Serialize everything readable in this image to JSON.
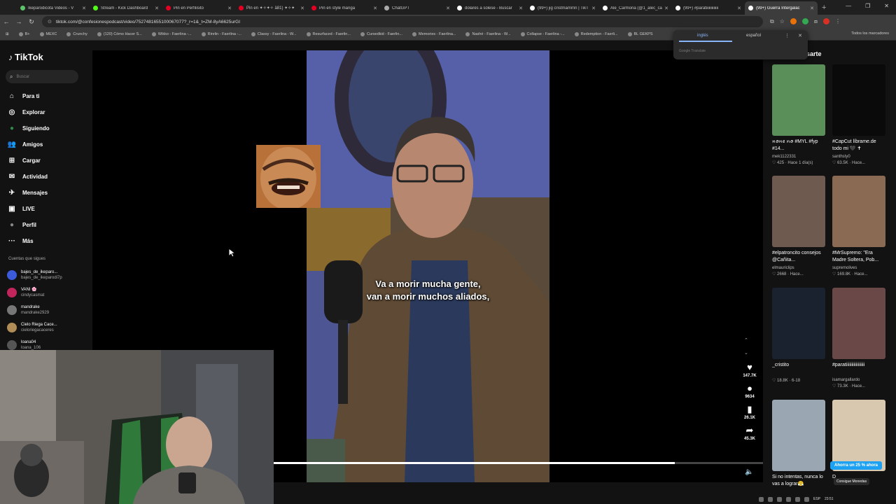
{
  "browser": {
    "tabs": [
      {
        "title": "Ikeparodicota Videos - V",
        "color": "#5ec26a"
      },
      {
        "title": "Stream - Kick Dashboard",
        "color": "#53fc18"
      },
      {
        "title": "Pin en Perfilisito",
        "color": "#e60023"
      },
      {
        "title": "Pin en ✦✧✦✧ ä81) ✦✧✦",
        "color": "#e60023"
      },
      {
        "title": "Pin en style manga",
        "color": "#e60023"
      },
      {
        "title": "ChatGPT",
        "color": "#aaaaaa"
      },
      {
        "title": "dolares a solese - Buscar",
        "color": "#ffffff"
      },
      {
        "title": "(99+) jig cristmamrnn | TikT",
        "color": "#ffffff"
      },
      {
        "title": "Ale_Carmona (@1_alec_ca",
        "color": "#ffffff"
      },
      {
        "title": "(99+) #paratiiiiiiiiiiiii",
        "color": "#ffffff"
      },
      {
        "title": "(99+) Guerra Intergalac",
        "color": "#ffffff"
      }
    ],
    "url": "tiktok.com/@confesionespodcast/video/7527481655100067077?_r=1&_t=ZM-8yA6625urGI",
    "bookmarks": [
      "B+",
      "MEXC",
      "Crunchy",
      "(120) Cómo Hacer S...",
      "Wikko - Faerlina -...",
      "Rinrlin - Faerlina -...",
      "Classy - Faerlina - W...",
      "Resurfaced - Faerlin...",
      "Cursedkid - Faerlin...",
      "Memories - Faerlina...",
      "Nashé - Faerlina - W...",
      "Collapse - Faerlina -...",
      "Redemption - Faerli...",
      "BL GEKPS"
    ],
    "bookmarks_right": "Todos los marcadores"
  },
  "translate": {
    "lang1": "inglés",
    "lang2": "español",
    "footer": "Google Translate"
  },
  "sidebar": {
    "logo": "TikTok",
    "search_placeholder": "Buscar",
    "nav": [
      {
        "label": "Para ti",
        "icon": "home-icon",
        "glyph": "⌂"
      },
      {
        "label": "Explorar",
        "icon": "compass-icon",
        "glyph": "◎"
      },
      {
        "label": "Siguiendo",
        "icon": "following-avatar-icon",
        "glyph": "●"
      },
      {
        "label": "Amigos",
        "icon": "friends-icon",
        "glyph": "👥"
      },
      {
        "label": "Cargar",
        "icon": "upload-icon",
        "glyph": "⊞"
      },
      {
        "label": "Actividad",
        "icon": "activity-icon",
        "glyph": "✉"
      },
      {
        "label": "Mensajes",
        "icon": "messages-icon",
        "glyph": "✈"
      },
      {
        "label": "LIVE",
        "icon": "live-icon",
        "glyph": "▣"
      },
      {
        "label": "Perfil",
        "icon": "profile-icon",
        "glyph": "●"
      },
      {
        "label": "Más",
        "icon": "more-icon",
        "glyph": "···"
      }
    ],
    "follow_title": "Cuentas que sigues",
    "follows": [
      {
        "name": "bajes_de_ikeparo...",
        "user": "bajes_de_ikeparodi7p",
        "color": "#3b5bdb"
      },
      {
        "name": "VANI 🌸",
        "user": "cindycasmat",
        "color": "#c2255c"
      },
      {
        "name": "mandrake",
        "user": "mandrake2929",
        "color": "#777777"
      },
      {
        "name": "Cielo Riega Cace...",
        "user": "cieloriegacaceres",
        "color": "#b08d57"
      },
      {
        "name": "loana04",
        "user": "loana_106",
        "color": "#555555"
      }
    ]
  },
  "video": {
    "caption_line1": "Va a morir mucha gente,",
    "caption_line2": "van a morir muchos aliados,",
    "progress": 0.82,
    "actions": [
      {
        "icon": "heart-icon",
        "glyph": "♥",
        "count": "147.7K"
      },
      {
        "icon": "comment-icon",
        "glyph": "●",
        "count": "9634"
      },
      {
        "icon": "bookmark-icon",
        "glyph": "▮",
        "count": "26.1K"
      },
      {
        "icon": "share-icon",
        "glyph": "➦",
        "count": "45.3K"
      }
    ]
  },
  "recommendations": {
    "title": "sarte",
    "items": [
      {
        "title": "ꪀꪮꪀꫀ ꪀꪮ #MYL #fyp #14...",
        "user": "mek1122331",
        "meta": "♡ 425 · Hace 1 día(s)",
        "bg": "#5a8f5a"
      },
      {
        "title": "#CapCut líbrame.de todo mi 🖤 ✝",
        "user": "santhsty0",
        "meta": "♡ 63.5K · Hace...",
        "bg": "#0a0a0a"
      },
      {
        "title": "#elpatroncito consejos @Cañita...",
        "user": "elmauriclips",
        "meta": "♡ 2668 · Hace...",
        "bg": "#6e5a4e"
      },
      {
        "title": "#MrSupremo: \"Era Madre Soltera, Pob...",
        "user": "supremolives",
        "meta": "♡ 169.8K · Hace...",
        "bg": "#8a6a52"
      },
      {
        "title": "_cristito",
        "user": "",
        "meta": "♡ 18.8K · 6-18",
        "bg": "#1a2230"
      },
      {
        "title": "#paratiiiiiiiiiiiiiiiii",
        "user": "isamargallardo",
        "meta": "♡ 73.3K · Hace...",
        "bg": "#6a4848"
      },
      {
        "title": "Si no intentas, nunca lo vas a lograr😤",
        "user": "",
        "meta": "",
        "bg": "#9aa6b2"
      },
      {
        "title": "D",
        "user": "",
        "meta": "",
        "bg": "#d8c8b0"
      }
    ],
    "coin_offer": "Ahorra un 25 % ahora",
    "coin_button": "Consigue Monedas"
  },
  "tray": {
    "lang": "ESP",
    "time": "23:51"
  }
}
